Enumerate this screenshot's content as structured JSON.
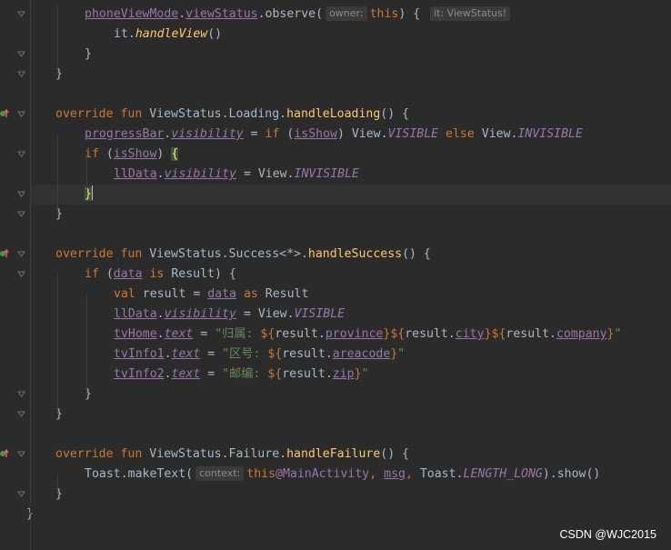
{
  "editor": {
    "lines": [
      {
        "indent": 2,
        "tokens": [
          [
            "prop",
            "phoneViewMode"
          ],
          [
            "",
            "."
          ],
          [
            "prop",
            "viewStatus"
          ],
          [
            "",
            "."
          ],
          [
            "",
            "observe("
          ],
          [
            "hint",
            "owner:"
          ],
          [
            "kw",
            "this"
          ],
          [
            "",
            ") { "
          ],
          [
            "hint",
            "it: ViewStatus!"
          ]
        ]
      },
      {
        "indent": 3,
        "tokens": [
          [
            "",
            "it."
          ],
          [
            "ital-fn",
            "handleView"
          ],
          [
            "",
            "()"
          ]
        ]
      },
      {
        "indent": 2,
        "tokens": [
          [
            "",
            "}"
          ]
        ]
      },
      {
        "indent": 1,
        "tokens": [
          [
            "",
            "}"
          ]
        ]
      },
      {
        "indent": 0,
        "tokens": []
      },
      {
        "indent": 1,
        "tokens": [
          [
            "kw",
            "override fun "
          ],
          [
            "",
            "ViewStatus.Loading."
          ],
          [
            "fn",
            "handleLoading"
          ],
          [
            "",
            "() {"
          ]
        ]
      },
      {
        "indent": 2,
        "tokens": [
          [
            "prop",
            "progressBar"
          ],
          [
            "",
            "."
          ],
          [
            "propi",
            "visibility"
          ],
          [
            "",
            " = "
          ],
          [
            "kw",
            "if "
          ],
          [
            "",
            "("
          ],
          [
            "prop",
            "isShow"
          ],
          [
            "",
            ") View."
          ],
          [
            "consti",
            "VISIBLE"
          ],
          [
            "kw",
            " else "
          ],
          [
            "",
            "View."
          ],
          [
            "consti",
            "INVISIBLE"
          ]
        ]
      },
      {
        "indent": 2,
        "tokens": [
          [
            "kw",
            "if "
          ],
          [
            "",
            "("
          ],
          [
            "prop",
            "isShow"
          ],
          [
            "",
            ") "
          ],
          [
            "brace-hl",
            "{"
          ]
        ]
      },
      {
        "indent": 3,
        "tokens": [
          [
            "prop",
            "llData"
          ],
          [
            "",
            "."
          ],
          [
            "propi",
            "visibility"
          ],
          [
            "",
            " = View."
          ],
          [
            "consti",
            "INVISIBLE"
          ]
        ]
      },
      {
        "indent": 2,
        "tokens": [
          [
            "brace-hl",
            "}"
          ],
          [
            "caret",
            ""
          ]
        ]
      },
      {
        "indent": 1,
        "tokens": [
          [
            "",
            "}"
          ]
        ]
      },
      {
        "indent": 0,
        "tokens": []
      },
      {
        "indent": 1,
        "tokens": [
          [
            "kw",
            "override fun "
          ],
          [
            "",
            "ViewStatus.Success<*>."
          ],
          [
            "fn",
            "handleSuccess"
          ],
          [
            "",
            "() {"
          ]
        ]
      },
      {
        "indent": 2,
        "tokens": [
          [
            "kw",
            "if "
          ],
          [
            "",
            "("
          ],
          [
            "prop",
            "data"
          ],
          [
            "kw",
            " is "
          ],
          [
            "",
            "Result) {"
          ]
        ]
      },
      {
        "indent": 3,
        "tokens": [
          [
            "kw",
            "val "
          ],
          [
            "",
            "result = "
          ],
          [
            "prop",
            "data"
          ],
          [
            "kw",
            " as "
          ],
          [
            "",
            "Result"
          ]
        ]
      },
      {
        "indent": 3,
        "tokens": [
          [
            "prop",
            "llData"
          ],
          [
            "",
            "."
          ],
          [
            "propi",
            "visibility"
          ],
          [
            "",
            " = View."
          ],
          [
            "consti",
            "VISIBLE"
          ]
        ]
      },
      {
        "indent": 3,
        "tokens": [
          [
            "prop",
            "tvHome"
          ],
          [
            "",
            "."
          ],
          [
            "propi",
            "text"
          ],
          [
            "",
            " = "
          ],
          [
            "str",
            "\"归属: "
          ],
          [
            "tmpl",
            "${"
          ],
          [
            "",
            "result."
          ],
          [
            "prop",
            "province"
          ],
          [
            "tmpl",
            "}${"
          ],
          [
            "",
            "result."
          ],
          [
            "prop",
            "city"
          ],
          [
            "tmpl",
            "}${"
          ],
          [
            "",
            "result."
          ],
          [
            "prop",
            "company"
          ],
          [
            "tmpl",
            "}"
          ],
          [
            "str",
            "\""
          ]
        ]
      },
      {
        "indent": 3,
        "tokens": [
          [
            "prop",
            "tvInfo1"
          ],
          [
            "",
            "."
          ],
          [
            "propi",
            "text"
          ],
          [
            "",
            " = "
          ],
          [
            "str",
            "\"区号: "
          ],
          [
            "tmpl",
            "${"
          ],
          [
            "",
            "result."
          ],
          [
            "prop",
            "areacode"
          ],
          [
            "tmpl",
            "}"
          ],
          [
            "str",
            "\""
          ]
        ]
      },
      {
        "indent": 3,
        "tokens": [
          [
            "prop",
            "tvInfo2"
          ],
          [
            "",
            "."
          ],
          [
            "propi",
            "text"
          ],
          [
            "",
            " = "
          ],
          [
            "str",
            "\"邮编: "
          ],
          [
            "tmpl",
            "${"
          ],
          [
            "",
            "result."
          ],
          [
            "prop",
            "zip"
          ],
          [
            "tmpl",
            "}"
          ],
          [
            "str",
            "\""
          ]
        ]
      },
      {
        "indent": 2,
        "tokens": [
          [
            "",
            "}"
          ]
        ]
      },
      {
        "indent": 1,
        "tokens": [
          [
            "",
            "}"
          ]
        ]
      },
      {
        "indent": 0,
        "tokens": []
      },
      {
        "indent": 1,
        "tokens": [
          [
            "kw",
            "override fun "
          ],
          [
            "",
            "ViewStatus.Failure."
          ],
          [
            "fn",
            "handleFailure"
          ],
          [
            "",
            "() {"
          ]
        ]
      },
      {
        "indent": 2,
        "tokens": [
          [
            "",
            "Toast.makeText("
          ],
          [
            "hint",
            "context:"
          ],
          [
            "kw",
            "this"
          ],
          [
            "lbl",
            "@MainActivity"
          ],
          [
            "kw",
            ", "
          ],
          [
            "prop",
            "msg"
          ],
          [
            "kw",
            ", "
          ],
          [
            "",
            "Toast."
          ],
          [
            "consti",
            "LENGTH_LONG"
          ],
          [
            "",
            ").show()"
          ]
        ]
      },
      {
        "indent": 1,
        "tokens": [
          [
            "",
            "}"
          ]
        ]
      },
      {
        "indent": 0,
        "tokens": [
          [
            "",
            "}"
          ]
        ]
      }
    ]
  },
  "watermark": "CSDN @WJC2015",
  "colors": {
    "background": "#2b2b2b",
    "keyword": "#cc7832",
    "function": "#ffc66d",
    "property": "#9876aa",
    "string": "#6a8759",
    "default": "#a9b7c6"
  }
}
